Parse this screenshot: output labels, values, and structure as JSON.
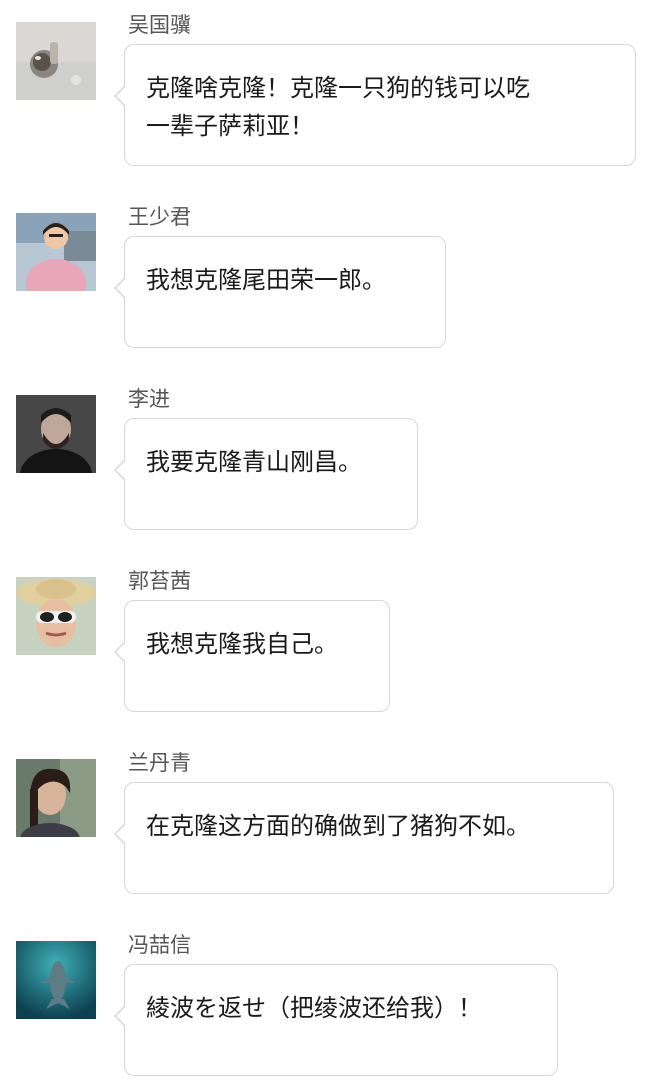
{
  "comments": [
    {
      "name": "吴国骥",
      "avatar": "avatar-glass-ball",
      "text": "克隆啥克隆！克隆一只狗的钱可以吃\n一辈子萨莉亚！"
    },
    {
      "name": "王少君",
      "avatar": "avatar-woman-pink-sweater",
      "text": "我想克隆尾田荣一郎。"
    },
    {
      "name": "李进",
      "avatar": "avatar-bearded-man",
      "text": "我要克隆青山刚昌。"
    },
    {
      "name": "郭苔茜",
      "avatar": "avatar-straw-hat-sunglasses",
      "text": "我想克隆我自己。"
    },
    {
      "name": "兰丹青",
      "avatar": "avatar-woman-portrait",
      "text": "在克隆这方面的确做到了猪狗不如。"
    },
    {
      "name": "冯喆信",
      "avatar": "avatar-dolphin-underwater",
      "text": "綾波を返せ（把绫波还给我）！"
    }
  ]
}
